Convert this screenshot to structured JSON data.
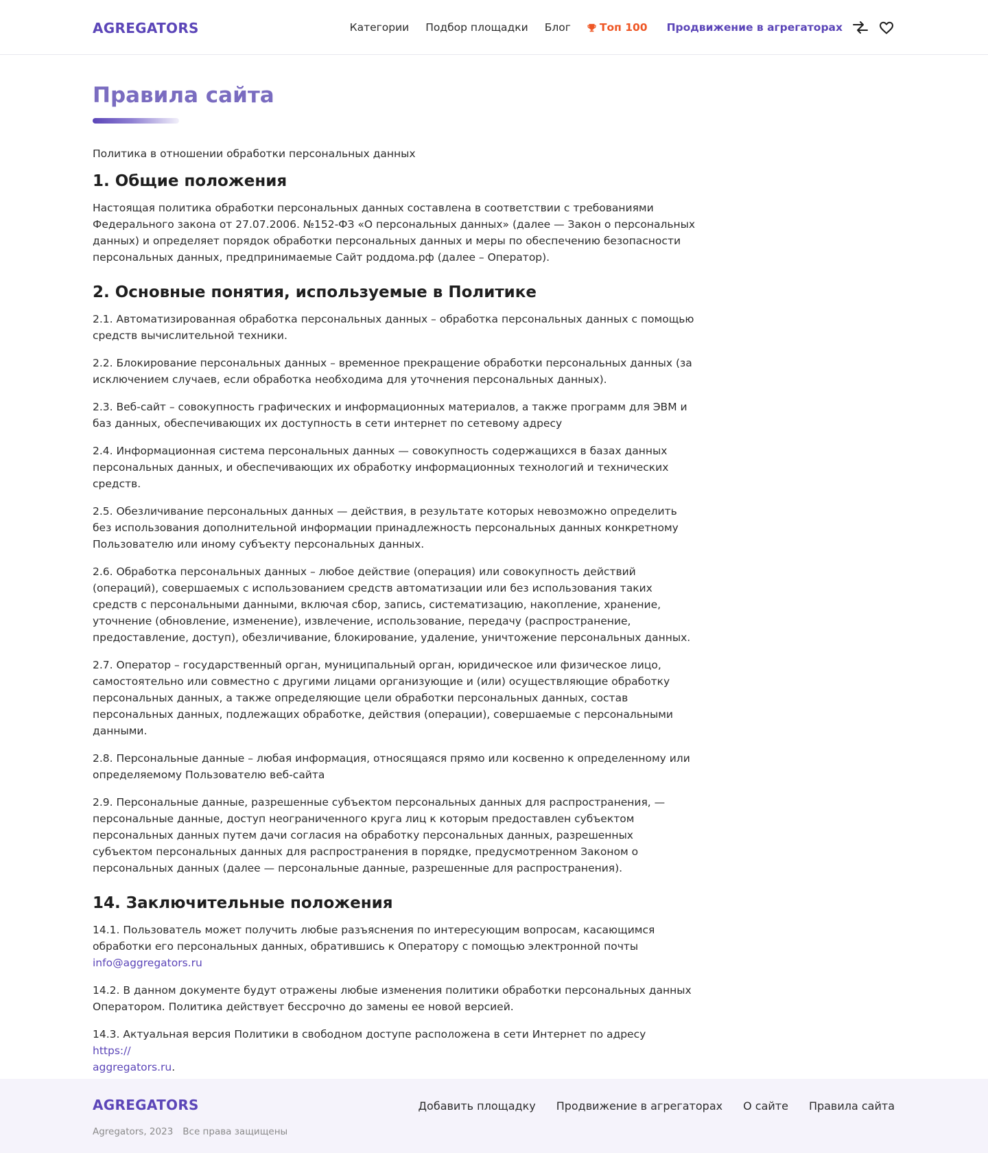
{
  "header": {
    "logo": "AGREGATORS",
    "nav": {
      "categories": "Категории",
      "venue_selection": "Подбор площадки",
      "blog": "Блог",
      "top100": "Топ 100",
      "promotion": "Продвижение в агрегаторах"
    },
    "icons": {
      "top100_icon": "trophy-icon",
      "compare_icon": "compare-arrows-icon",
      "favorites_icon": "heart-icon"
    }
  },
  "page": {
    "title": "Правила сайта",
    "subtitle": "Политика в отношении обработки персональных данных",
    "sections": [
      {
        "heading": "1. Общие положения",
        "paragraphs": [
          "Настоящая политика обработки персональных данных составлена в соответствии с требованиями Федерального закона от 27.07.2006. №152-ФЗ «О персональных данных» (далее — Закон о персональных данных) и определяет порядок обработки персональных данных и меры по обеспечению безопасности персональных данных, предпринимаемые Сайт роддома.рф (далее – Оператор)."
        ]
      },
      {
        "heading": "2. Основные понятия, используемые в Политике",
        "paragraphs": [
          "2.1. Автоматизированная обработка персональных данных – обработка персональных данных с помощью средств вычислительной техники.",
          "2.2. Блокирование персональных данных – временное прекращение обработки персональных данных (за исключением случаев, если обработка необходима для уточнения персональных данных).",
          "2.3. Веб-сайт – совокупность графических и информационных материалов, а также программ для ЭВМ и баз данных, обеспечивающих их доступность в сети интернет по сетевому адресу",
          "2.4. Информационная система персональных данных — совокупность содержащихся в базах данных персональных данных, и обеспечивающих их обработку информационных технологий и технических средств.",
          "2.5. Обезличивание персональных данных — действия, в результате которых невозможно определить без использования дополнительной информации принадлежность персональных данных конкретному Пользователю или иному субъекту персональных данных.",
          "2.6. Обработка персональных данных – любое действие (операция) или совокупность действий (операций), совершаемых с использованием средств автоматизации или без использования таких средств с персональными данными, включая сбор, запись, систематизацию, накопление, хранение, уточнение (обновление, изменение), извлечение, использование, передачу (распространение, предоставление, доступ), обезличивание, блокирование, удаление, уничтожение персональных данных.",
          "2.7. Оператор – государственный орган, муниципальный орган, юридическое или физическое лицо, самостоятельно или совместно с другими лицами организующие и (или) осуществляющие обработку персональных данных, а также определяющие цели обработки персональных данных, состав персональных данных, подлежащих обработке, действия (операции), совершаемые с персональными данными.",
          "2.8. Персональные данные – любая информация, относящаяся прямо или косвенно к определенному или определяемому Пользователю веб-сайта",
          "2.9. Персональные данные, разрешенные субъектом персональных данных для распространения, — персональные данные, доступ неограниченного круга лиц к которым предоставлен субъектом персональных данных путем дачи согласия на обработку персональных данных, разрешенных субъектом персональных данных для распространения в порядке, предусмотренном Законом о персональных данных (далее — персональные данные, разрешенные для распространения)."
        ]
      },
      {
        "heading": "14. Заключительные положения",
        "p1_text": "14.1. Пользователь может получить любые разъяснения по интересующим вопросам, касающимся обработки его персональных данных, обратившись к Оператору с помощью электронной почты ",
        "p1_link": "info@aggregators.ru",
        "p2_text": "14.2. В данном документе будут отражены любые изменения политики обработки персональных данных Оператором. Политика действует бессрочно до замены ее новой версией.",
        "p3_text": "14.3. Актуальная версия Политики в свободном доступе расположена в сети Интернет по адресу",
        "p3_link_part1": "https://",
        "p3_link_part2": "aggregators.ru",
        "p3_end": "."
      }
    ]
  },
  "footer": {
    "logo": "AGREGATORS",
    "copyright": "Agregators, 2023",
    "rights": "Все права защищены",
    "nav": {
      "add_venue": "Добавить площадку",
      "promotion": "Продвижение в агрегаторах",
      "about": "О сайте",
      "rules": "Правила сайта"
    }
  },
  "colors": {
    "brand": "#5b45b8",
    "title": "#7a6cc0",
    "accent_top": "#ee5624",
    "footer_bg": "#f5f3fb"
  }
}
